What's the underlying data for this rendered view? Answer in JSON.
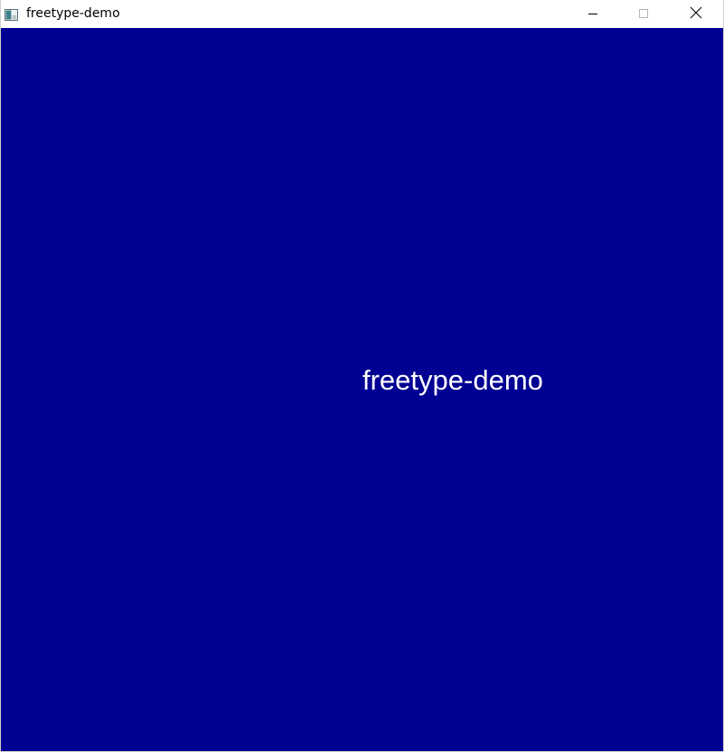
{
  "window": {
    "title": "freetype-demo",
    "icon": "app-window-icon"
  },
  "controls": {
    "minimize_icon": "minimize-icon",
    "maximize_icon": "maximize-icon",
    "close_icon": "close-icon"
  },
  "canvas": {
    "background_color": "#000092",
    "text_color": "#ffffff",
    "rendered_text": "freetype-demo"
  }
}
